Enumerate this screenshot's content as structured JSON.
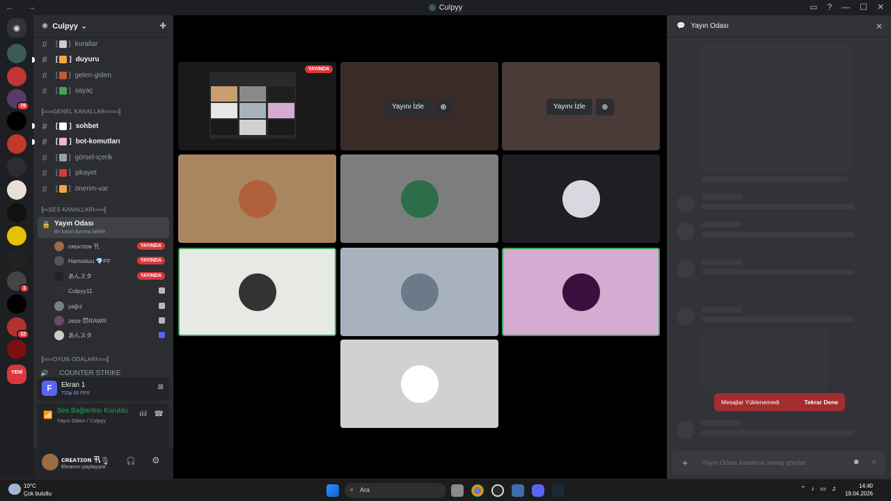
{
  "titlebar": {
    "app_title": "Culpyy"
  },
  "rail": {
    "badges": [
      "78",
      "1",
      "12"
    ],
    "new_label": "YENİ",
    "colors": [
      "#3b5b55",
      "#c03535",
      "#5a3a6b",
      "#000000",
      "#c0392b",
      "#2b2d31",
      "#e8e0d8",
      "#111111",
      "#e5c100",
      "#222222",
      "#444444",
      "#000000",
      "#b83030",
      "#7a1010",
      "#2d6b3c"
    ]
  },
  "sidebar": {
    "server_name": "Culpyy",
    "channels": [
      {
        "label": "kurallar",
        "emoji_color": "#cccccc",
        "unread": false
      },
      {
        "label": "duyuru",
        "emoji_color": "#f3a640",
        "unread": true
      },
      {
        "label": "gelen-giden",
        "emoji_color": "#c05a3a",
        "unread": false
      },
      {
        "label": "sayaç",
        "emoji_color": "#3ba55c",
        "unread": false
      }
    ],
    "category_general": "╠══GENEL KANALLAR═══╣",
    "channels_general": [
      {
        "label": "sohbet",
        "emoji_color": "#ffffff",
        "unread": true
      },
      {
        "label": "bot-komutları",
        "emoji_color": "#f0b0e0",
        "unread": true
      },
      {
        "label": "görsel-içerik",
        "emoji_color": "#9aa0a6",
        "unread": false
      },
      {
        "label": "şikayet",
        "emoji_color": "#da373c",
        "unread": false
      },
      {
        "label": "önerim-var",
        "emoji_color": "#f3a640",
        "unread": false
      }
    ],
    "category_voice": "╠═SES KANALLARI══╣",
    "voice_channel": {
      "name": "Yayın Odası",
      "status": "Bir kanal durumu belirle"
    },
    "voice_users": [
      {
        "name": "ᴄʀᴇᴀᴛɪᴏɴ 卂",
        "live": true,
        "live_label": "YAYINDA",
        "avatar": "#9a6b45"
      },
      {
        "name": "Hamsiiiuu 💎PF",
        "live": true,
        "live_label": "YAYINDA",
        "avatar": "#555555"
      },
      {
        "name": "あんスタ",
        "live": true,
        "live_label": "YAYINDA",
        "avatar": "#222222"
      },
      {
        "name": "Culpyy11",
        "live": false,
        "avatar": "#2e3035"
      },
      {
        "name": "yağız",
        "live": false,
        "avatar": "#7a7d82"
      },
      {
        "name": "zeze 😈RAWR",
        "live": false,
        "avatar": "#6b4a6b"
      },
      {
        "name": "あんスタ",
        "live": false,
        "avatar": "#cccccc"
      }
    ],
    "category_game": "╠══OYUN ODALARI══╣",
    "game_channel": "COUNTER STRIKE",
    "screen_share": {
      "title": "Ekran 1",
      "quality": "720p 60 FPS",
      "icon_letter": "F"
    },
    "voice_status": {
      "title": "Ses Bağlantısı Kuruldu",
      "subtitle": "Yayın Odası / Culpyy"
    },
    "user": {
      "name": "ᴄʀᴇᴀᴛɪᴏɴ 卂",
      "status": "Ekranını paylaşıyor"
    }
  },
  "stage": {
    "live_badge": "YAYINDA",
    "watch_label": "Yayını İzle",
    "tiles": [
      {
        "type": "stream",
        "bg": "#1a1a1a"
      },
      {
        "type": "stream-hidden",
        "bg": "#3a2a28"
      },
      {
        "type": "stream-hidden",
        "bg": "#4a3a38"
      },
      {
        "type": "avatar",
        "bg": "#a98560",
        "avatar": "#b0603a"
      },
      {
        "type": "avatar",
        "bg": "#7c7e7e",
        "avatar": "#2d6d4a"
      },
      {
        "type": "avatar",
        "bg": "#1e1f22",
        "avatar": "#d8d8e0"
      },
      {
        "type": "avatar",
        "bg": "#e6e9e4",
        "avatar": "#333333",
        "speaking": true
      },
      {
        "type": "avatar",
        "bg": "#a7b2bd",
        "avatar": "#6b7a88"
      },
      {
        "type": "avatar",
        "bg": "#d6abd1",
        "avatar": "#3b1040",
        "speaking": true
      },
      {
        "type": "avatar",
        "bg": "#d1d1d1",
        "avatar": "#ffffff"
      }
    ]
  },
  "chat": {
    "title": "Yayın Odası",
    "error_text": "Mesajlar Yüklenemedi",
    "retry_label": "Tekrar Dene",
    "placeholder": "Yayın Odası kanalına mesaj gönder"
  },
  "taskbar": {
    "weather_temp": "10°C",
    "weather_text": "Çok bulutlu",
    "search_placeholder": "Ara",
    "time": "14:40",
    "date": "19.04.2026"
  }
}
